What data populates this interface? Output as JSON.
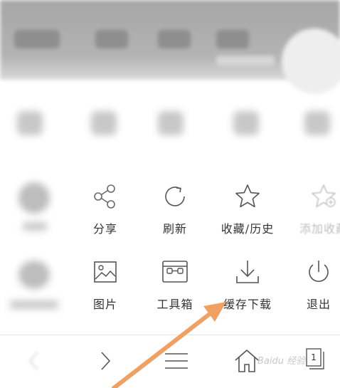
{
  "menu": {
    "row1": [
      {
        "label": "分享",
        "icon": "share-icon"
      },
      {
        "label": "刷新",
        "icon": "refresh-icon"
      },
      {
        "label": "收藏/历史",
        "icon": "star-icon"
      },
      {
        "label": "添加收藏",
        "icon": "star-add-icon"
      }
    ],
    "row2": [
      {
        "label": "图片",
        "icon": "image-icon"
      },
      {
        "label": "工具箱",
        "icon": "toolbox-icon"
      },
      {
        "label": "缓存下载",
        "icon": "download-icon"
      },
      {
        "label": "退出",
        "icon": "power-icon"
      }
    ]
  },
  "bottom_nav": {
    "tab_count": "1",
    "icons": [
      "back-icon",
      "forward-icon",
      "menu-icon",
      "home-icon",
      "tabs-icon"
    ]
  },
  "watermark": "Baidu 经验",
  "colors": {
    "arrow": "#f0a060",
    "icon": "#555555",
    "text": "#333333"
  }
}
